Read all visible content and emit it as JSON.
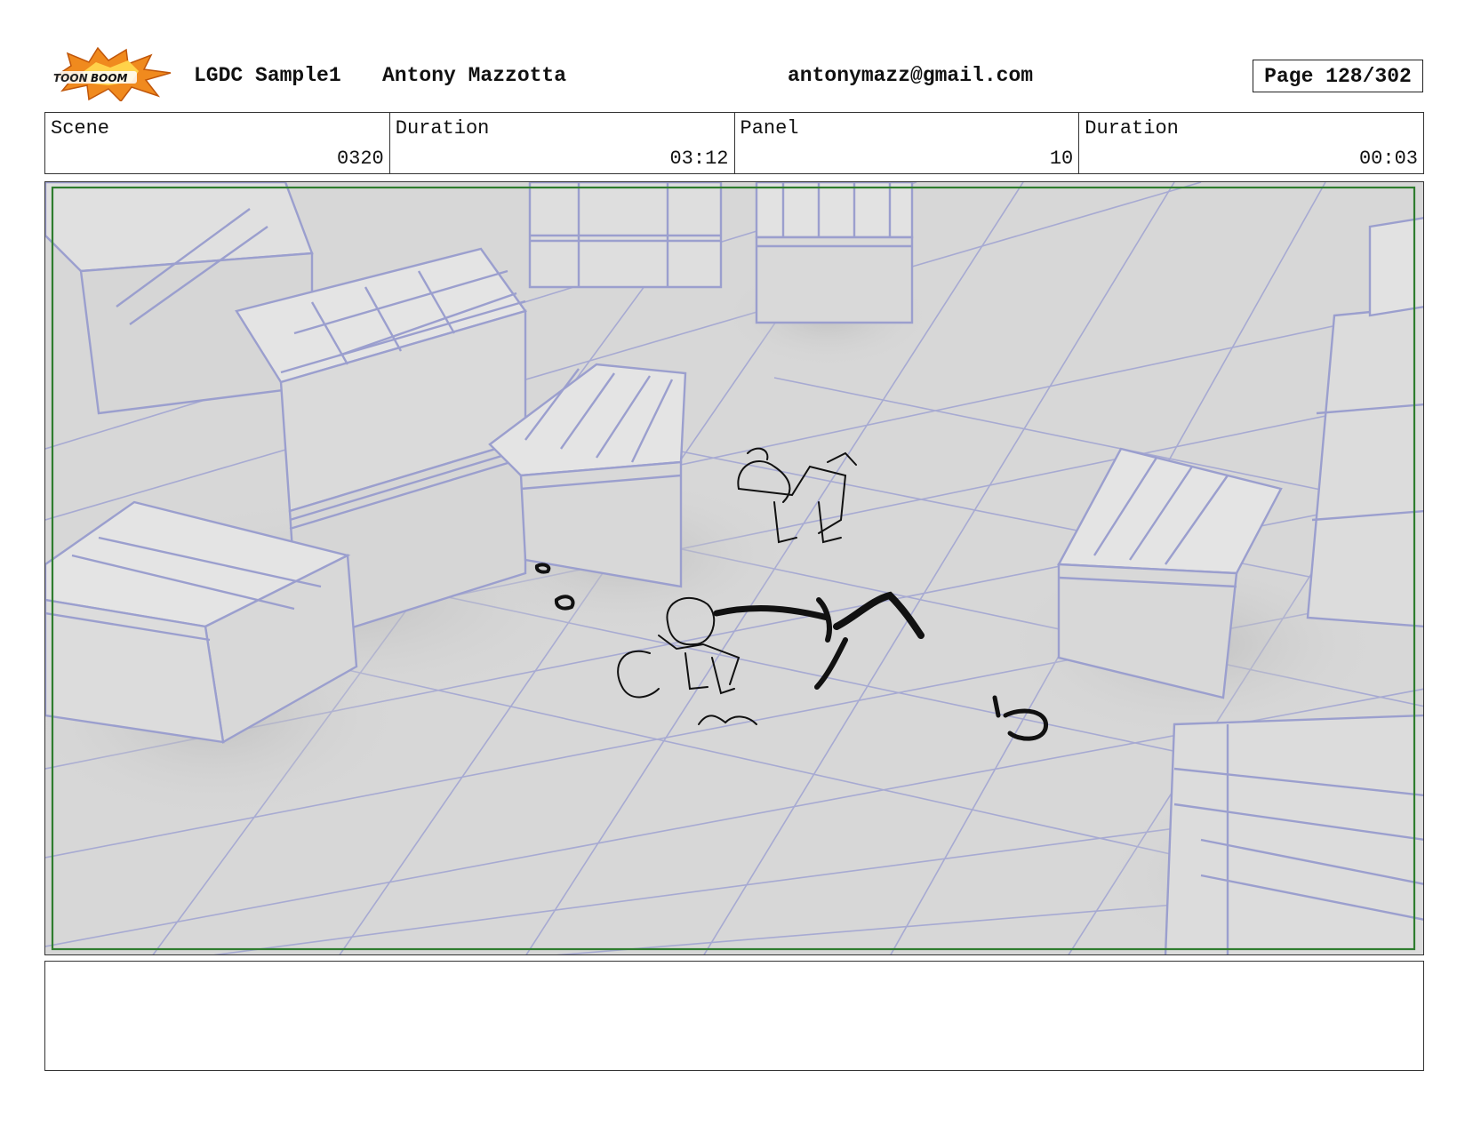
{
  "header": {
    "logo_text": "TOONBOOM",
    "project": "LGDC Sample1",
    "author": "Antony Mazzotta",
    "email": "antonymazz@gmail.com",
    "page": "Page 128/302"
  },
  "info": {
    "scene_label": "Scene",
    "scene_value": "0320",
    "scene_duration_label": "Duration",
    "scene_duration_value": "03:12",
    "panel_label": "Panel",
    "panel_value": "10",
    "panel_duration_label": "Duration",
    "panel_duration_value": "00:03"
  },
  "colors": {
    "crate_lines": "#9b9fce",
    "floor": "#d7d7d7",
    "safe_frame": "#2f7d2f",
    "sketch": "#111111",
    "logo_burst": "#f08a1e"
  },
  "notes": {
    "text": ""
  }
}
